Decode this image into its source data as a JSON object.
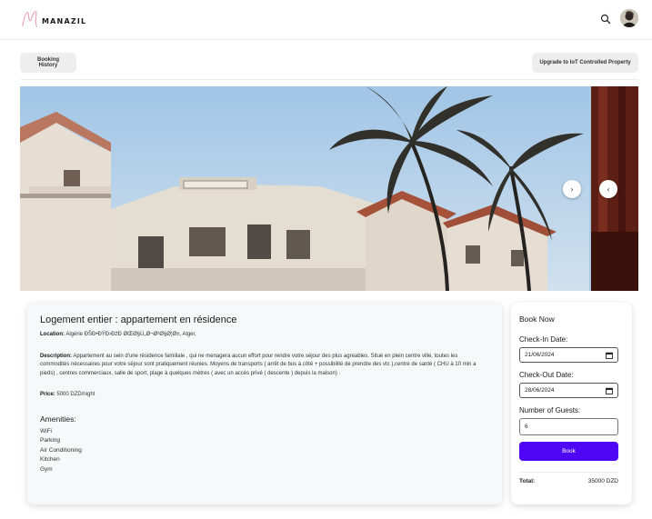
{
  "brand": {
    "name": "MANAZIL"
  },
  "header": {
    "icons": [
      "search-icon",
      "avatar"
    ]
  },
  "actions": {
    "booking_history": "Booking History",
    "upgrade": "Upgrade to IoT Controlled Property"
  },
  "gallery": {
    "next_icon": "›",
    "prev_icon": "‹"
  },
  "listing": {
    "title": "Logement entier : appartement en résidence",
    "location_label": "Location:",
    "location_value": "Algérie ÐŠÐ•ÐŸÐ›ÐžÐ ØŒØ§Ù„Ø¬Ø²Ø§Ø¦Ø±, Alger,",
    "description_label": "Description:",
    "description_value": "Appartement au sein d'une résidence familiale , qui ne menagera aucun effort pour rendre votre séjour des plus agreables. Situé en plein centre ville, toutes les commodités nécessaires pour votre séjour sont pratiquement réunies. Moyens de transports ( arrêt de bus à côté + possibilité de prendre des vtc ),centre de santé ( CHU à 10 min a pieds) , centres commerciaux, salle de sport, plage à quelques mètres ( avec un accès privé ( descente ) depuis la maison) .",
    "price_label": "Price:",
    "price_value": "5000 DZD/night",
    "amenities_title": "Amenities:",
    "amenities": [
      "WiFi",
      "Parking",
      "Air Conditioning",
      "Kitchen",
      "Gym"
    ]
  },
  "booking": {
    "title": "Book Now",
    "checkin_label": "Check-In Date:",
    "checkin_value": "21/06/2024",
    "checkout_label": "Check-Out Date:",
    "checkout_value": "28/06/2024",
    "guests_label": "Number of Guests:",
    "guests_value": "6",
    "book_button": "Book",
    "total_label": "Total:",
    "total_value": "35000 DZD",
    "accent_color": "#4f06f5"
  }
}
